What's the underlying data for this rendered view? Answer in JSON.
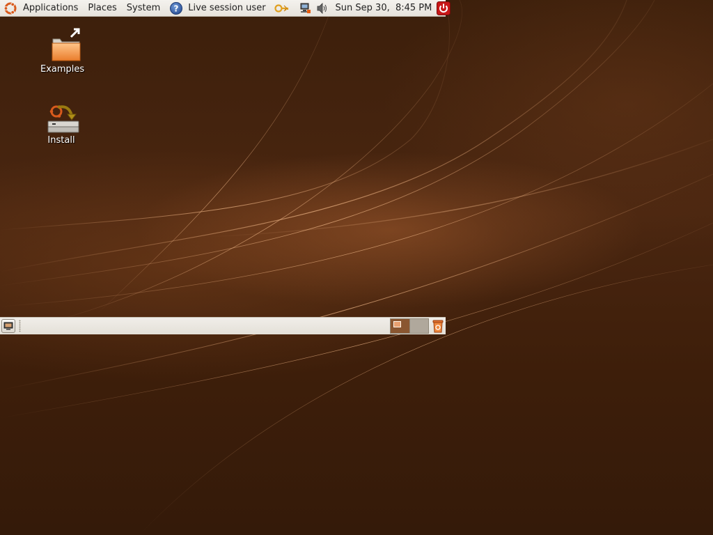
{
  "top_panel": {
    "menus": {
      "applications": "Applications",
      "places": "Places",
      "system": "System"
    },
    "help_icon": "help-icon",
    "user_label": "Live session user",
    "tray_icons": [
      "keyring-icon",
      "network-icon",
      "volume-icon"
    ],
    "clock": "Sun Sep 30,  8:45 PM",
    "power_icon": "power-icon"
  },
  "desktop_icons": [
    {
      "label": "Examples",
      "icon": "folder-link-icon"
    },
    {
      "label": "Install",
      "icon": "install-drive-icon"
    }
  ],
  "bottom_panel": {
    "show_desktop_icon": "show-desktop-icon",
    "workspaces": [
      "workspace-1",
      "workspace-2"
    ],
    "active_workspace": 1,
    "trash_icon": "trash-icon"
  },
  "colors": {
    "accent": "#d95a1c",
    "panel_bg": "#ece9e3",
    "wallpaper": "#3d1e0a"
  }
}
